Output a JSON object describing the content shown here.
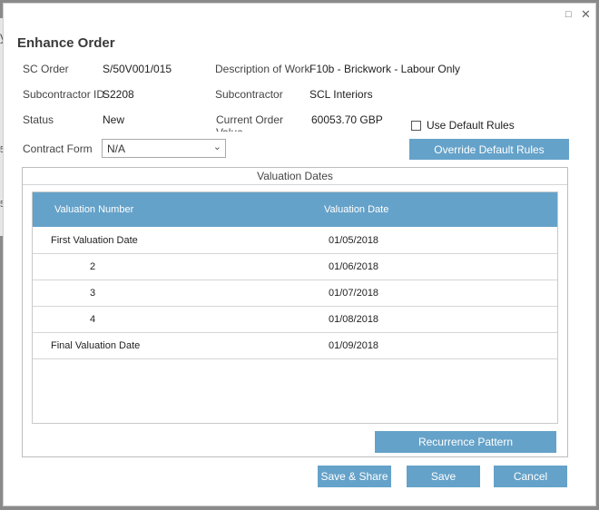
{
  "background": {
    "fragments": [
      "y",
      "5",
      "5"
    ]
  },
  "window_controls": {
    "restore": "□",
    "close": "✕"
  },
  "dialog": {
    "title": "Enhance Order"
  },
  "fields": {
    "sc_order": {
      "label": "SC Order",
      "value": "S/50V001/015"
    },
    "description_of_work": {
      "label": "Description of Work",
      "value": "F10b - Brickwork - Labour Only"
    },
    "subcontractor_id": {
      "label": "Subcontractor ID",
      "value": "S2208"
    },
    "subcontractor": {
      "label": "Subcontractor",
      "value": "SCL Interiors"
    },
    "status": {
      "label": "Status",
      "value": "New"
    },
    "current_order_value": {
      "label": "Current Order Value",
      "value": "60053.70 GBP"
    },
    "contract_form": {
      "label": "Contract Form",
      "value": "N/A"
    }
  },
  "use_default_rules": {
    "label": "Use Default Rules",
    "checked": false
  },
  "buttons": {
    "override_default_rules": "Override Default Rules",
    "recurrence_pattern": "Recurrence Pattern",
    "save_share": "Save & Share",
    "save": "Save",
    "cancel": "Cancel"
  },
  "valuation_dates": {
    "title": "Valuation Dates",
    "columns": [
      "Valuation Number",
      "Valuation Date"
    ],
    "rows": [
      {
        "number": "First Valuation Date",
        "date": "01/05/2018"
      },
      {
        "number": "2",
        "date": "01/06/2018"
      },
      {
        "number": "3",
        "date": "01/07/2018"
      },
      {
        "number": "4",
        "date": "01/08/2018"
      },
      {
        "number": "Final Valuation Date",
        "date": "01/09/2018"
      }
    ]
  },
  "colors": {
    "accent": "#65a2c9",
    "header_text": "#ffffff"
  }
}
